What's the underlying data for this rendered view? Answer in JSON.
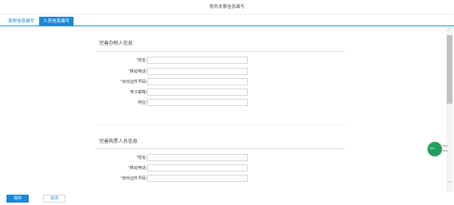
{
  "window": {
    "title": "税务发票信息编写"
  },
  "tabs": [
    {
      "label": "保税信息编写",
      "active": false
    },
    {
      "label": "人员信息编写",
      "active": true
    }
  ],
  "section1": {
    "title": "完善办税人信息",
    "fields": [
      {
        "label": "姓名:",
        "required": true,
        "value": ""
      },
      {
        "label": "移动电话:",
        "required": true,
        "value": ""
      },
      {
        "label": "身份证件号码:",
        "required": true,
        "value": ""
      },
      {
        "label": "电子邮箱:",
        "required": false,
        "value": ""
      },
      {
        "label": "地址:",
        "required": false,
        "value": ""
      }
    ]
  },
  "section2": {
    "title": "完善购票人员信息",
    "fields": [
      {
        "label": "姓名:",
        "required": true,
        "value": ""
      },
      {
        "label": "移动电话:",
        "required": true,
        "value": ""
      },
      {
        "label": "身份证件号码:",
        "required": true,
        "value": ""
      }
    ]
  },
  "required_mark": "*",
  "widget": {
    "label": "65%",
    "stat1": "0K/s",
    "stat2": "0K/s"
  },
  "buttons": {
    "save": "保存",
    "close": "关闭"
  },
  "colors": {
    "accent": "#1e88d4",
    "required": "#e3342f",
    "widget": "#21a05a"
  }
}
